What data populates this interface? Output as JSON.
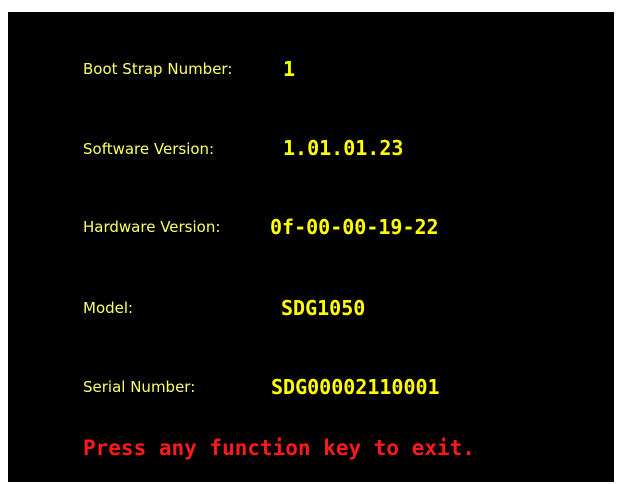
{
  "colors": {
    "background": "#000000",
    "label": "#ffff66",
    "value": "#ffff00",
    "warning": "#ff1a1a"
  },
  "info": {
    "boot_strap_label": "Boot Strap Number:",
    "boot_strap_value": "1",
    "software_label": "Software Version:",
    "software_value": "1.01.01.23",
    "hardware_label": "Hardware Version:",
    "hardware_value": "0f-00-00-19-22",
    "model_label": "Model:",
    "model_value": "SDG1050",
    "serial_label": "Serial Number:",
    "serial_value": "SDG00002110001"
  },
  "footer": {
    "exit_message": "Press any function key to exit."
  }
}
